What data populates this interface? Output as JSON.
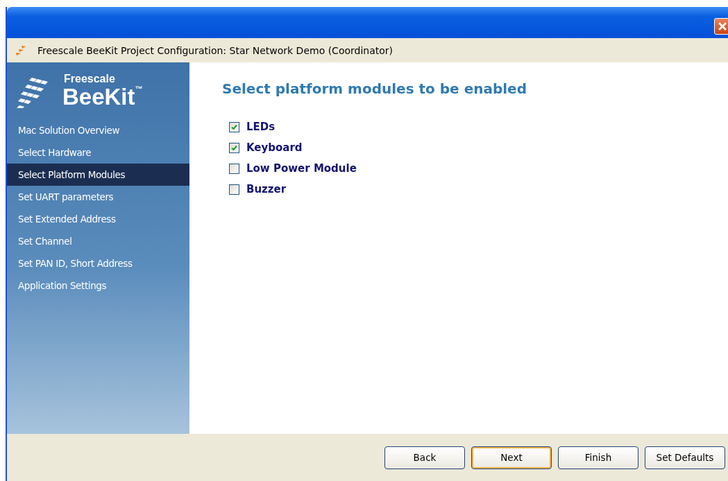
{
  "window": {
    "title": "Freescale BeeKit Project Configuration: Star Network Demo (Coordinator)"
  },
  "brand": {
    "company": "Freescale",
    "product": "BeeKit",
    "mark": "™"
  },
  "sidebar": {
    "items": [
      {
        "label": "Mac Solution Overview",
        "selected": false
      },
      {
        "label": "Select Hardware",
        "selected": false
      },
      {
        "label": "Select Platform Modules",
        "selected": true
      },
      {
        "label": "Set UART parameters",
        "selected": false
      },
      {
        "label": "Set Extended Address",
        "selected": false
      },
      {
        "label": "Set Channel",
        "selected": false
      },
      {
        "label": "Set PAN ID, Short Address",
        "selected": false
      },
      {
        "label": "Application Settings",
        "selected": false
      }
    ]
  },
  "heading": "Select platform modules to be enabled",
  "modules": [
    {
      "label": "LEDs",
      "checked": true
    },
    {
      "label": "Keyboard",
      "checked": true
    },
    {
      "label": "Low Power Module",
      "checked": false
    },
    {
      "label": "Buzzer",
      "checked": false
    }
  ],
  "buttons": [
    {
      "label": "Back",
      "default": false
    },
    {
      "label": "Next",
      "default": true
    },
    {
      "label": "Finish",
      "default": false
    },
    {
      "label": "Set Defaults",
      "default": false
    }
  ]
}
